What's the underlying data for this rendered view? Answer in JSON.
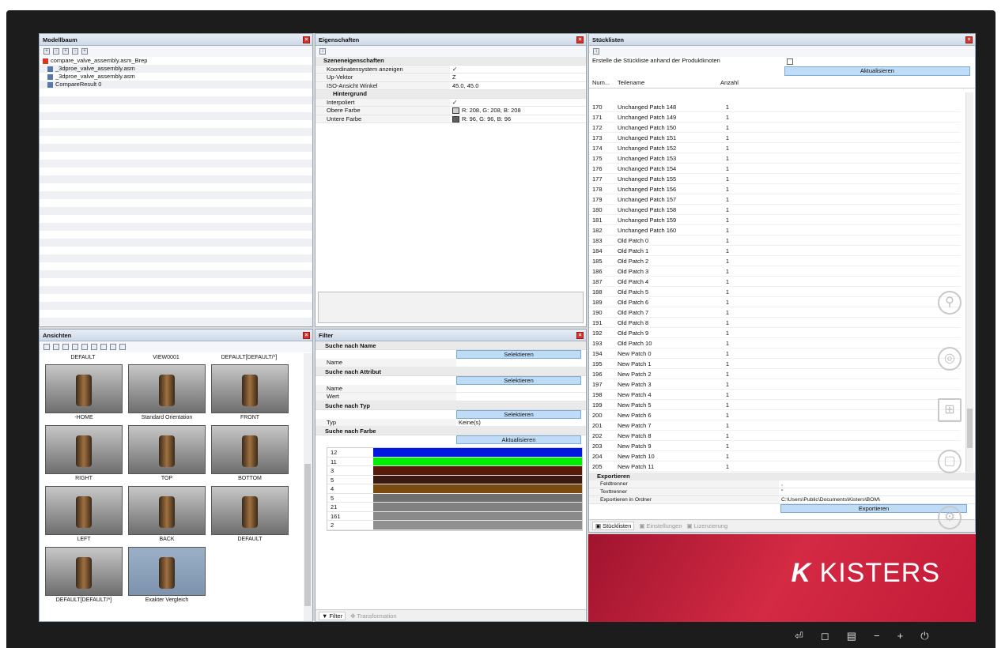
{
  "modelbaum": {
    "title": "Modellbaum",
    "items": [
      {
        "label": "compare_valve_assembly.asm_Brep",
        "indent": 0
      },
      {
        "label": "_3dproe_valve_assembly.asm",
        "indent": 1
      },
      {
        "label": "_3dproe_valve_assembly.asm",
        "indent": 1
      },
      {
        "label": "CompareResult 0",
        "indent": 1
      }
    ]
  },
  "eigenschaften": {
    "title": "Eigenschaften",
    "rows": [
      {
        "label": "Szeneneigenschaften",
        "value": "",
        "type": "group"
      },
      {
        "label": "Koordinatensystem anzeigen",
        "value": "✓",
        "type": "check"
      },
      {
        "label": "Up-Vektor",
        "value": "Z",
        "type": "select"
      },
      {
        "label": "ISO-Ansicht Winkel",
        "value": "45.0, 45.0",
        "type": "expand"
      },
      {
        "label": "Hintergrund",
        "value": "",
        "type": "group2"
      },
      {
        "label": "Interpoliert",
        "value": "✓",
        "type": "check"
      },
      {
        "label": "Obere Farbe",
        "value": "R: 208, G: 208, B: 208",
        "type": "color",
        "color": "#d0d0d0"
      },
      {
        "label": "Untere Farbe",
        "value": "R: 96, G: 96, B: 96",
        "type": "color",
        "color": "#606060"
      }
    ]
  },
  "stuecklisten": {
    "title": "Stücklisten",
    "create_label": "Erstelle die Stückliste anhand der Produktknoten",
    "update_btn": "Aktualisieren",
    "columns": [
      "Num...",
      "Teilename",
      "Anzahl"
    ],
    "rows": [
      [
        "170",
        "Unchanged Patch 148",
        "1"
      ],
      [
        "171",
        "Unchanged Patch 149",
        "1"
      ],
      [
        "172",
        "Unchanged Patch 150",
        "1"
      ],
      [
        "173",
        "Unchanged Patch 151",
        "1"
      ],
      [
        "174",
        "Unchanged Patch 152",
        "1"
      ],
      [
        "175",
        "Unchanged Patch 153",
        "1"
      ],
      [
        "176",
        "Unchanged Patch 154",
        "1"
      ],
      [
        "177",
        "Unchanged Patch 155",
        "1"
      ],
      [
        "178",
        "Unchanged Patch 156",
        "1"
      ],
      [
        "179",
        "Unchanged Patch 157",
        "1"
      ],
      [
        "180",
        "Unchanged Patch 158",
        "1"
      ],
      [
        "181",
        "Unchanged Patch 159",
        "1"
      ],
      [
        "182",
        "Unchanged Patch 160",
        "1"
      ],
      [
        "183",
        "Old Patch 0",
        "1"
      ],
      [
        "184",
        "Old Patch 1",
        "1"
      ],
      [
        "185",
        "Old Patch 2",
        "1"
      ],
      [
        "186",
        "Old Patch 3",
        "1"
      ],
      [
        "187",
        "Old Patch 4",
        "1"
      ],
      [
        "188",
        "Old Patch 5",
        "1"
      ],
      [
        "189",
        "Old Patch 6",
        "1"
      ],
      [
        "190",
        "Old Patch 7",
        "1"
      ],
      [
        "191",
        "Old Patch 8",
        "1"
      ],
      [
        "192",
        "Old Patch 9",
        "1"
      ],
      [
        "193",
        "Old Patch 10",
        "1"
      ],
      [
        "194",
        "New Patch 0",
        "1"
      ],
      [
        "195",
        "New Patch 1",
        "1"
      ],
      [
        "196",
        "New Patch 2",
        "1"
      ],
      [
        "197",
        "New Patch 3",
        "1"
      ],
      [
        "198",
        "New Patch 4",
        "1"
      ],
      [
        "199",
        "New Patch 5",
        "1"
      ],
      [
        "200",
        "New Patch 6",
        "1"
      ],
      [
        "201",
        "New Patch 7",
        "1"
      ],
      [
        "202",
        "New Patch 8",
        "1"
      ],
      [
        "203",
        "New Patch 9",
        "1"
      ],
      [
        "204",
        "New Patch 10",
        "1"
      ],
      [
        "205",
        "New Patch 11",
        "1"
      ]
    ],
    "export": {
      "title": "Exportieren",
      "rows": [
        [
          "Feldtrenner",
          ","
        ],
        [
          "Texttrenner",
          "\""
        ],
        [
          "Exportieren in Ordner",
          "C:\\Users\\Public\\Documents\\Kisters\\BOM\\"
        ]
      ],
      "button": "Exportieren"
    },
    "tabs": [
      "Stücklisten",
      "Einstellungen",
      "Lizenzierung"
    ]
  },
  "ansichten": {
    "title": "Ansichten",
    "top_labels": [
      "DEFAULT",
      "VIEW0001",
      "DEFAULT[DEFAULT/*]"
    ],
    "views": [
      "-HOME",
      "Standard Orientation",
      "FRONT",
      "RIGHT",
      "TOP",
      "BOTTOM",
      "LEFT",
      "BACK",
      "DEFAULT",
      "DEFAULT[DEFAULT/*]",
      "Exakter Vergleich"
    ]
  },
  "filter": {
    "title": "Filter",
    "sections": {
      "name": "Suche nach Name",
      "attr": "Suche nach Attribut",
      "typ": "Suche nach Typ",
      "farbe": "Suche nach Farbe"
    },
    "select_btn": "Selektieren",
    "update_btn": "Aktualisieren",
    "name_label": "Name",
    "wert_label": "Wert",
    "typ_label": "Typ",
    "typ_value": "Keine(s)",
    "colors": [
      {
        "count": "12",
        "color": "#0018e0"
      },
      {
        "count": "11",
        "color": "#00ee00"
      },
      {
        "count": "3",
        "color": "#5a1a0a"
      },
      {
        "count": "5",
        "color": "#3a1a10"
      },
      {
        "count": "4",
        "color": "#7a4a10"
      },
      {
        "count": "5",
        "color": "#707070"
      },
      {
        "count": "21",
        "color": "#808080"
      },
      {
        "count": "161",
        "color": "#8a8a8a"
      },
      {
        "count": "2",
        "color": "#909090"
      }
    ],
    "tabs": [
      "Filter",
      "Transformation"
    ]
  },
  "brand": {
    "logo": "KISTERS",
    "accent": "#c81e3c"
  },
  "icons": {
    "bezel": [
      "back-icon",
      "home-icon",
      "menu-icon",
      "minus-icon",
      "plus-icon",
      "power-icon"
    ],
    "side": [
      "search-icon",
      "3d-icon",
      "windows-icon",
      "view-icon",
      "settings-icon"
    ]
  }
}
